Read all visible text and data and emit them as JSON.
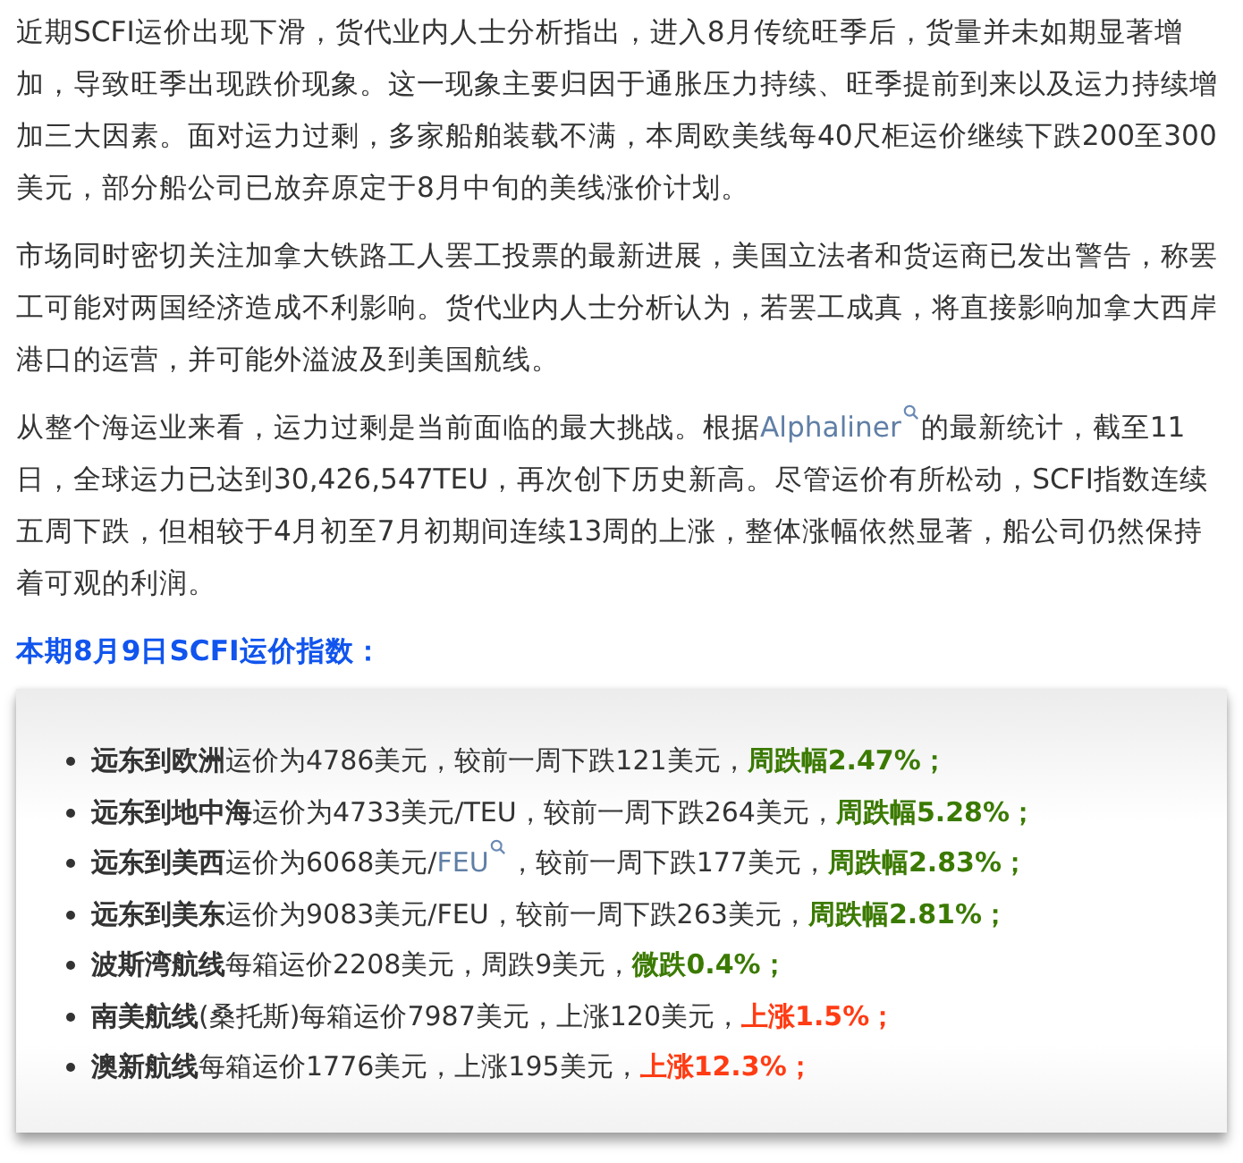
{
  "paragraphs": [
    {
      "segments": [
        {
          "kind": "text",
          "text": "近期SCFI运价出现下滑，货代业内人士分析指出，进入8月传统旺季后，货量并未如期显著增加，导致旺季出现跌价现象。这一现象主要归因于通胀压力持续、旺季提前到来以及运力持续增加三大因素。面对运力过剩，多家船舶装载不满，本周欧美线每40尺柜运价继续下跌200至300美元，部分船公司已放弃原定于8月中旬的美线涨价计划。"
        }
      ]
    },
    {
      "segments": [
        {
          "kind": "text",
          "text": "市场同时密切关注加拿大铁路工人罢工投票的最新进展，美国立法者和货运商已发出警告，称罢工可能对两国经济造成不利影响。货代业内人士分析认为，若罢工成真，将直接影响加拿大西岸港口的运营，并可能外溢波及到美国航线。"
        }
      ]
    },
    {
      "segments": [
        {
          "kind": "text",
          "text": "从整个海运业来看，运力过剩是当前面临的最大挑战。根据"
        },
        {
          "kind": "link",
          "text": "Alphaliner"
        },
        {
          "kind": "text",
          "text": "的最新统计，截至11日，全球运力已达到30,426,547TEU，再次创下历史新高。尽管运价有所松动，SCFI指数连续五周下跌，但相较于4月初至7月初期间连续13周的上涨，整体涨幅依然显著，船公司仍然保持着可观的利润。"
        }
      ]
    }
  ],
  "heading": "本期8月9日SCFI运价指数：",
  "routes": [
    {
      "route": "远东到欧洲",
      "segments": [
        {
          "kind": "text",
          "text": "运价为4786美元，较前一周下跌121美元，"
        }
      ],
      "change": "周跌幅2.47%；",
      "color": "#3b7a00"
    },
    {
      "route": "远东到地中海",
      "segments": [
        {
          "kind": "text",
          "text": "运价为4733美元/TEU，较前一周下跌264美元，"
        }
      ],
      "change": "周跌幅5.28%；",
      "color": "#3b7a00"
    },
    {
      "route": "远东到美西",
      "segments": [
        {
          "kind": "text",
          "text": "运价为6068美元/"
        },
        {
          "kind": "link",
          "text": "FEU"
        },
        {
          "kind": "text",
          "text": "，较前一周下跌177美元，"
        }
      ],
      "change": "周跌幅2.83%；",
      "color": "#3b7a00"
    },
    {
      "route": "远东到美东",
      "segments": [
        {
          "kind": "text",
          "text": "运价为9083美元/FEU，较前一周下跌263美元，"
        }
      ],
      "change": "周跌幅2.81%；",
      "color": "#3b7a00"
    },
    {
      "route": "波斯湾航线",
      "segments": [
        {
          "kind": "text",
          "text": "每箱运价2208美元，周跌9美元，"
        }
      ],
      "change": "微跌0.4%；",
      "color": "#3b7a00"
    },
    {
      "route": "南美航线",
      "segments": [
        {
          "kind": "text",
          "text": "(桑托斯)每箱运价7987美元，上涨120美元，"
        }
      ],
      "change": "上涨1.5%；",
      "color": "#ff3c14"
    },
    {
      "route": "澳新航线",
      "segments": [
        {
          "kind": "text",
          "text": "每箱运价1776美元，上涨195美元，"
        }
      ],
      "change": "上涨12.3%；",
      "color": "#ff3c14"
    }
  ]
}
